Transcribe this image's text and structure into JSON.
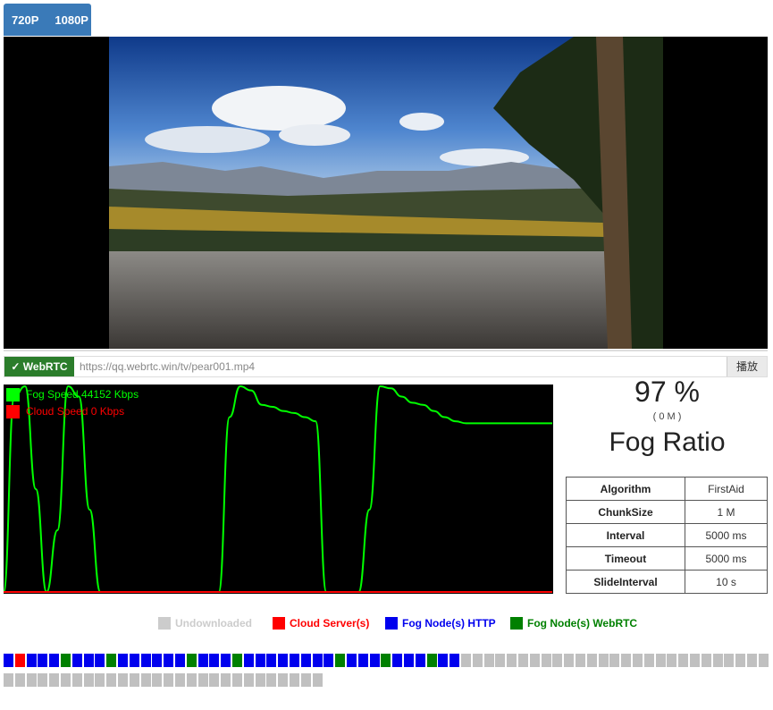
{
  "resolutions": [
    "720P",
    "1080P"
  ],
  "webrtc_button": "✓ WebRTC",
  "url_input": "https://qq.webrtc.win/tv/pear001.mp4",
  "play_button": "播放",
  "speed_legend": {
    "fog": "Fog Speed 44152 Kbps",
    "cloud": "Cloud Speed 0 Kbps"
  },
  "ratio": {
    "percent": "97 %",
    "size": "( 0 M )",
    "label": "Fog Ratio"
  },
  "stats": [
    {
      "key": "Algorithm",
      "value": "FirstAid"
    },
    {
      "key": "ChunkSize",
      "value": "1 M"
    },
    {
      "key": "Interval",
      "value": "5000 ms"
    },
    {
      "key": "Timeout",
      "value": "5000 ms"
    },
    {
      "key": "SlideInterval",
      "value": "10 s"
    }
  ],
  "status_legend": [
    {
      "label": "Undownloaded",
      "color": "#cccccc"
    },
    {
      "label": "Cloud Server(s)",
      "color": "#ff0000"
    },
    {
      "label": "Fog Node(s) HTTP",
      "color": "#0000ee"
    },
    {
      "label": "Fog Node(s) WebRTC",
      "color": "#008000"
    }
  ],
  "colors": {
    "fog": "#00ff00",
    "cloud": "#ff0000",
    "blue": "#0000ee",
    "green": "#008000",
    "grey": "#c0c0c0",
    "tab": "#3a7ab8",
    "webrtc": "#2b7d2b"
  },
  "chunks": "BRBBBGBBBGBBBBBBGBBBGBBBBBBBBGBBBGBBBGBB",
  "chunk_total": 95,
  "chart_data": {
    "type": "line",
    "series": [
      {
        "name": "Fog Speed",
        "color": "#00ff00",
        "values": [
          0,
          95,
          100,
          50,
          0,
          30,
          100,
          95,
          40,
          0,
          0,
          0,
          0,
          0,
          0,
          0,
          0,
          0,
          0,
          0,
          0,
          85,
          100,
          98,
          91,
          90,
          88,
          87,
          85,
          83,
          0,
          0,
          0,
          0,
          40,
          100,
          99,
          95,
          92,
          91,
          88,
          85,
          83,
          82,
          82,
          82,
          82,
          82,
          82,
          82,
          82,
          82
        ]
      },
      {
        "name": "Cloud Speed",
        "color": "#ff0000",
        "values": [
          0,
          0,
          0,
          0,
          0,
          0,
          0,
          0,
          0,
          0,
          0,
          0,
          0,
          0,
          0,
          0,
          0,
          0,
          0,
          0,
          0,
          0,
          0,
          0,
          0,
          0,
          0,
          0,
          0,
          0,
          0,
          0,
          0,
          0,
          0,
          0,
          0,
          0,
          0,
          0,
          0,
          0,
          0,
          0,
          0,
          0,
          0,
          0,
          0,
          0,
          0,
          0
        ]
      }
    ]
  }
}
